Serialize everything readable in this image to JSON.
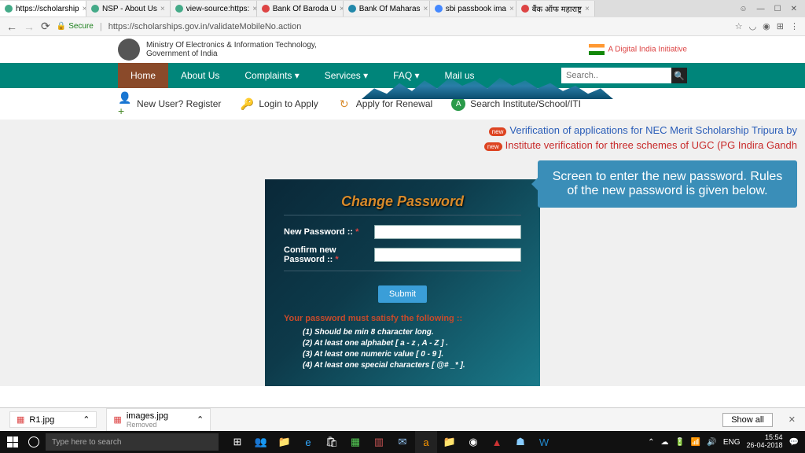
{
  "browser": {
    "tabs": [
      "https://scholarship",
      "NSP - About Us",
      "view-source:https:",
      "Bank Of Baroda U",
      "Bank Of Maharas",
      "sbi passbook ima",
      "बैंक ऑफ महाराष्ट्र"
    ],
    "secure_label": "Secure",
    "url": "https://scholarships.gov.in/validateMobileNo.action"
  },
  "header": {
    "ministry": "Ministry Of Electronics & Information Technology,",
    "govt": "Government of India",
    "dii": "A Digital India Initiative"
  },
  "nav": {
    "items": [
      "Home",
      "About Us",
      "Complaints ▾",
      "Services ▾",
      "FAQ ▾",
      "Mail us"
    ],
    "search_placeholder": "Search.."
  },
  "subnav": {
    "new_user": "New User? Register",
    "login": "Login to Apply",
    "renewal": "Apply for Renewal",
    "search_inst": "Search Institute/School/ITI"
  },
  "notifs": {
    "new_badge": "new",
    "line1": "Verification of applications for NEC Merit Scholarship Tripura by",
    "line2": "Institute verification for three schemes of UGC (PG Indira Gandh"
  },
  "callout": "Screen to enter the new password. Rules of the new password is given below.",
  "form": {
    "title": "Change Password",
    "new_pw": "New Password :: ",
    "confirm_pw": "Confirm new Password :: ",
    "star": "*",
    "submit": "Submit",
    "rules_title": "Your password must satisfy the following ::",
    "rules": [
      "(1) Should be min 8 character long.",
      "(2) At least one alphabet [ a - z , A - Z ] .",
      "(3) At least one numeric value [ 0 - 9 ].",
      "(4) At least one special characters [ @# _* ]."
    ]
  },
  "downloads": {
    "item1": "R1.jpg",
    "item2": "images.jpg",
    "item2_sub": "Removed",
    "show_all": "Show all"
  },
  "taskbar": {
    "search_placeholder": "Type here to search",
    "lang": "ENG",
    "time": "15:54",
    "date": "26-04-2018"
  }
}
